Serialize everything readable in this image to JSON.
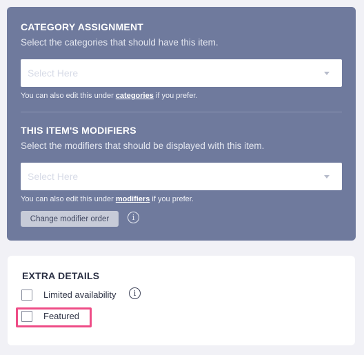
{
  "category": {
    "title": "CATEGORY ASSIGNMENT",
    "description": "Select the categories that should have this item.",
    "select_placeholder": "Select Here",
    "hint_prefix": "You can also edit this under ",
    "hint_link": "categories",
    "hint_suffix": " if you prefer."
  },
  "modifiers": {
    "title": "THIS ITEM'S MODIFIERS",
    "description": "Select the modifiers that should be displayed with this item.",
    "select_placeholder": "Select Here",
    "hint_prefix": "You can also edit this under ",
    "hint_link": "modifiers",
    "hint_suffix": " if you prefer.",
    "change_order_button": "Change modifier order",
    "info_glyph": "i"
  },
  "extra_details": {
    "title": "EXTRA DETAILS",
    "options": [
      {
        "label": "Limited availability",
        "checked": false,
        "info_glyph": "i"
      },
      {
        "label": "Featured",
        "checked": false
      }
    ]
  },
  "colors": {
    "panel_blue": "#6f7a9d",
    "highlight": "#ee4c86"
  },
  "icons": [
    "chevron-down-icon",
    "info-icon"
  ]
}
